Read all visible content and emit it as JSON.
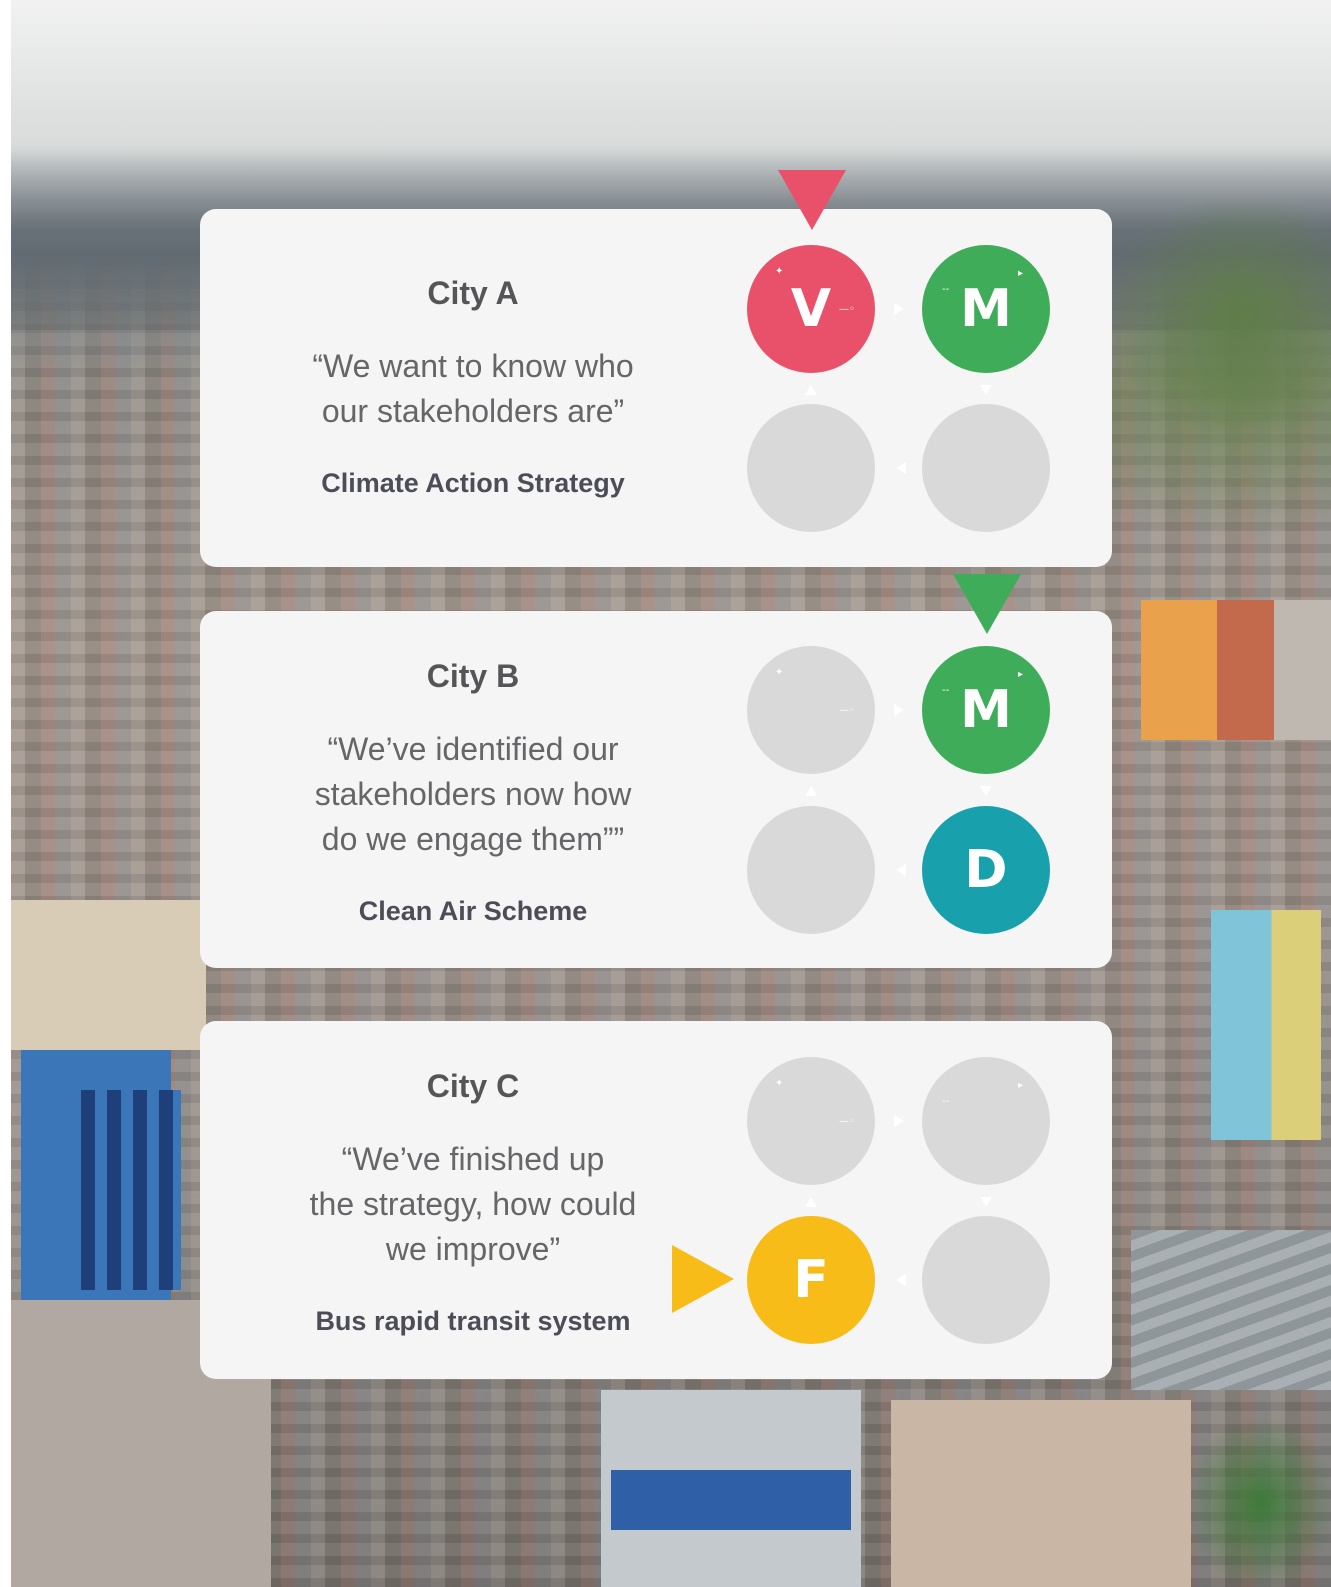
{
  "colors": {
    "vision": "#e9516a",
    "mobilise": "#3fac5a",
    "deliver": "#18a0ac",
    "finish": "#f8bc19",
    "inactive": "#d9d9d9",
    "card": "#f5f5f5"
  },
  "cards": [
    {
      "title": "City A",
      "quote_lines": [
        "“We want to know who",
        "our stakeholders are”"
      ],
      "project": "Climate Action Strategy",
      "active_letters": {
        "v": "V",
        "m": "M"
      },
      "pointer": "vision"
    },
    {
      "title": "City B",
      "quote_lines": [
        "“We’ve identified our",
        "stakeholders now how",
        "do we engage them””"
      ],
      "project": "Clean Air Scheme",
      "active_letters": {
        "m": "M",
        "d": "D"
      },
      "pointer": "mobilise"
    },
    {
      "title": "City C",
      "quote_lines": [
        "“We’ve finished up",
        "the strategy, how could",
        "we improve”"
      ],
      "project": "Bus rapid transit system",
      "active_letters": {
        "f": "F"
      },
      "pointer": "finish"
    }
  ]
}
